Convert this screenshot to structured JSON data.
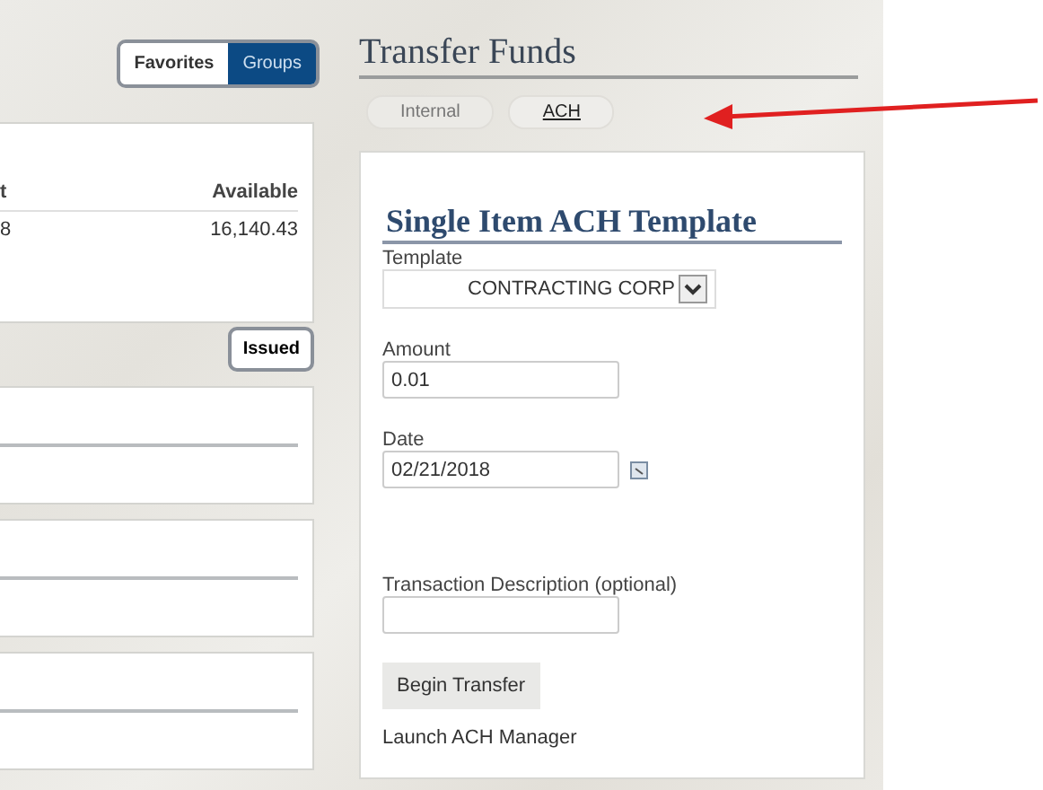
{
  "view_toggle": [
    {
      "label": "Favorites",
      "selected": false
    },
    {
      "label": "Groups",
      "selected": true
    }
  ],
  "accounts_table": {
    "columns": [
      "t",
      "Available"
    ],
    "rows": [
      [
        "8",
        "16,140.43"
      ]
    ]
  },
  "issued_button": {
    "label": "Issued"
  },
  "group_cards": [
    {
      "kind": "blank"
    },
    {
      "kind": "blank"
    },
    {
      "kind": "blank"
    }
  ],
  "transfer": {
    "title": "Transfer Funds",
    "tabs": [
      {
        "label": "Internal",
        "selected": false
      },
      {
        "label": "ACH",
        "selected": true
      }
    ],
    "form": {
      "heading": "Single Item ACH Template",
      "template": {
        "label": "Template",
        "value": "CONTRACTING CORP"
      },
      "amount": {
        "label": "Amount",
        "value": "0.01"
      },
      "date": {
        "label": "Date",
        "value": "02/21/2018"
      },
      "description": {
        "label": "Transaction Description (optional)"
      },
      "submit": "Begin Transfer",
      "link": "Launch ACH Manager"
    }
  }
}
